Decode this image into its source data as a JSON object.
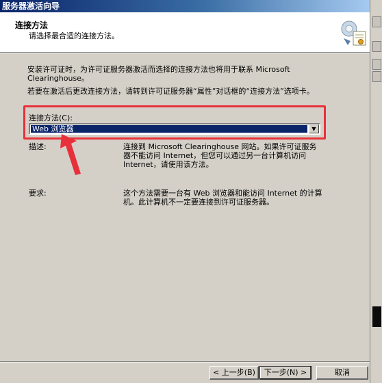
{
  "window": {
    "title": "服务器激活向导",
    "close_glyph": "×"
  },
  "header": {
    "title": "连接方法",
    "subtitle": "请选择最合适的连接方法。",
    "icon": "server-certificate-icon"
  },
  "body": {
    "intro": "安装许可证时，为许可证服务器激活而选择的连接方法也将用于联系 Microsoft Clearinghouse。",
    "intro2": "若要在激活后更改连接方法，请转到许可证服务器“属性”对话框的“连接方法”选项卡。",
    "connection_label": "连接方法(C):",
    "connection_value": "Web 浏览器",
    "description_label": "描述:",
    "description_text": "连接到 Microsoft Clearinghouse 网站。如果许可证服务器不能访问 Internet，但您可以通过另一台计算机访问 Internet，请使用该方法。",
    "requirement_label": "要求:",
    "requirement_text": "这个方法需要一台有 Web 浏览器和能访问 Internet 的计算机。此计算机不一定要连接到许可证服务器。"
  },
  "buttons": {
    "back": "< 上一步(B)",
    "next": "下一步(N) >",
    "cancel": "取消"
  },
  "annotation": {
    "highlight_color": "#e8303a"
  }
}
